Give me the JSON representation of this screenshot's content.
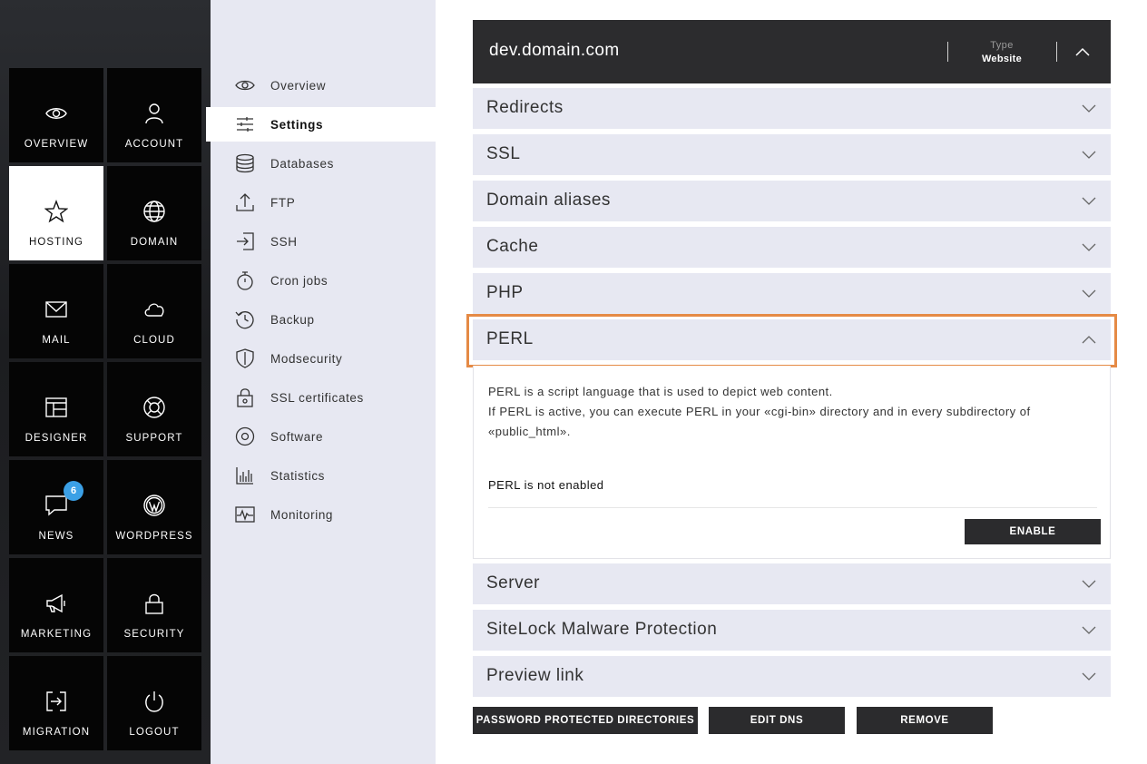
{
  "tiles": [
    {
      "label": "OVERVIEW",
      "icon": "eye-icon"
    },
    {
      "label": "ACCOUNT",
      "icon": "user-icon"
    },
    {
      "label": "HOSTING",
      "icon": "star-icon",
      "active": true
    },
    {
      "label": "DOMAIN",
      "icon": "globe-icon"
    },
    {
      "label": "MAIL",
      "icon": "envelope-icon"
    },
    {
      "label": "CLOUD",
      "icon": "cloud-icon"
    },
    {
      "label": "DESIGNER",
      "icon": "layout-icon"
    },
    {
      "label": "SUPPORT",
      "icon": "lifebuoy-icon"
    },
    {
      "label": "NEWS",
      "icon": "chat-bubble-icon",
      "badge": "6"
    },
    {
      "label": "WORDPRESS",
      "icon": "wordpress-icon"
    },
    {
      "label": "MARKETING",
      "icon": "megaphone-icon"
    },
    {
      "label": "SECURITY",
      "icon": "lock-icon"
    },
    {
      "label": "MIGRATION",
      "icon": "migration-icon"
    },
    {
      "label": "LOGOUT",
      "icon": "power-icon"
    }
  ],
  "menu": [
    {
      "label": "Overview",
      "icon": "eye-icon"
    },
    {
      "label": "Settings",
      "icon": "sliders-icon",
      "active": true
    },
    {
      "label": "Databases",
      "icon": "database-icon"
    },
    {
      "label": "FTP",
      "icon": "upload-icon"
    },
    {
      "label": "SSH",
      "icon": "login-icon"
    },
    {
      "label": "Cron jobs",
      "icon": "stopwatch-icon"
    },
    {
      "label": "Backup",
      "icon": "history-icon"
    },
    {
      "label": "Modsecurity",
      "icon": "shield-icon"
    },
    {
      "label": "SSL certificates",
      "icon": "certificate-lock-icon"
    },
    {
      "label": "Software",
      "icon": "disc-icon"
    },
    {
      "label": "Statistics",
      "icon": "bar-chart-icon"
    },
    {
      "label": "Monitoring",
      "icon": "pulse-icon"
    }
  ],
  "domain": {
    "name": "dev.domain.com",
    "type_label": "Type",
    "type_value": "Website"
  },
  "sections": [
    {
      "title": "Redirects",
      "expanded": false
    },
    {
      "title": "SSL",
      "expanded": false
    },
    {
      "title": "Domain aliases",
      "expanded": false
    },
    {
      "title": "Cache",
      "expanded": false
    },
    {
      "title": "PHP",
      "expanded": false
    },
    {
      "title": "PERL",
      "expanded": true
    },
    {
      "title": "Server",
      "expanded": false
    },
    {
      "title": "SiteLock Malware Protection",
      "expanded": false
    },
    {
      "title": "Preview link",
      "expanded": false
    }
  ],
  "perl": {
    "line1": "PERL is a script language that is used to depict web content.",
    "line2": "If PERL is active, you can execute PERL in your «cgi-bin» directory and in every subdirectory of «public_html».",
    "status": "PERL is not enabled",
    "enable_label": "ENABLE"
  },
  "actions": {
    "password_dirs": "PASSWORD PROTECTED DIRECTORIES",
    "edit_dns": "EDIT DNS",
    "remove": "REMOVE"
  },
  "colors": {
    "highlight": "#e58a45",
    "accent_badge": "#3ba0e6",
    "header_bg": "#2c2c2e",
    "section_bg": "#e7e8f2"
  }
}
